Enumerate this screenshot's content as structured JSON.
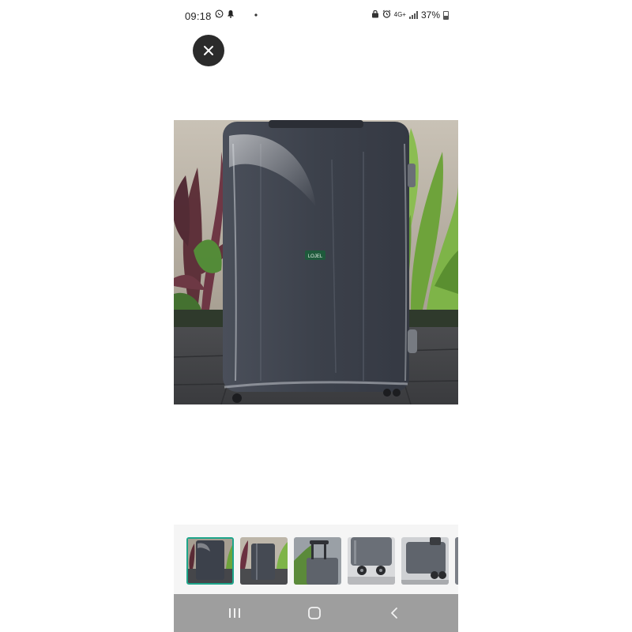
{
  "status_bar": {
    "time": "09:18",
    "network": "4G+",
    "battery_percent": "37%",
    "left_icons": [
      "whatsapp-icon",
      "notification-icon",
      "dot-icon"
    ],
    "right_icons": [
      "vpn-icon",
      "alarm-icon",
      "network-icon",
      "signal-icon",
      "battery-icon"
    ]
  },
  "viewer": {
    "close_icon": "close-icon",
    "main_image": "suitcase-with-clear-cover",
    "logo_text": "LOJEL"
  },
  "thumbnails": [
    {
      "name": "thumb-suitcase-cover-front",
      "selected": true
    },
    {
      "name": "thumb-suitcase-plants",
      "selected": false
    },
    {
      "name": "thumb-suitcase-handle",
      "selected": false
    },
    {
      "name": "thumb-suitcase-wheels",
      "selected": false
    },
    {
      "name": "thumb-suitcase-side",
      "selected": false
    },
    {
      "name": "thumb-suitcase-partial",
      "selected": false
    }
  ],
  "nav_bar": {
    "icons": [
      "recent-apps-icon",
      "home-icon",
      "back-icon"
    ]
  },
  "colors": {
    "accent": "#1ea58a",
    "nav_bg": "#9e9e9e",
    "strip_bg": "#f5f5f5",
    "close_bg": "#2b2b2b"
  }
}
